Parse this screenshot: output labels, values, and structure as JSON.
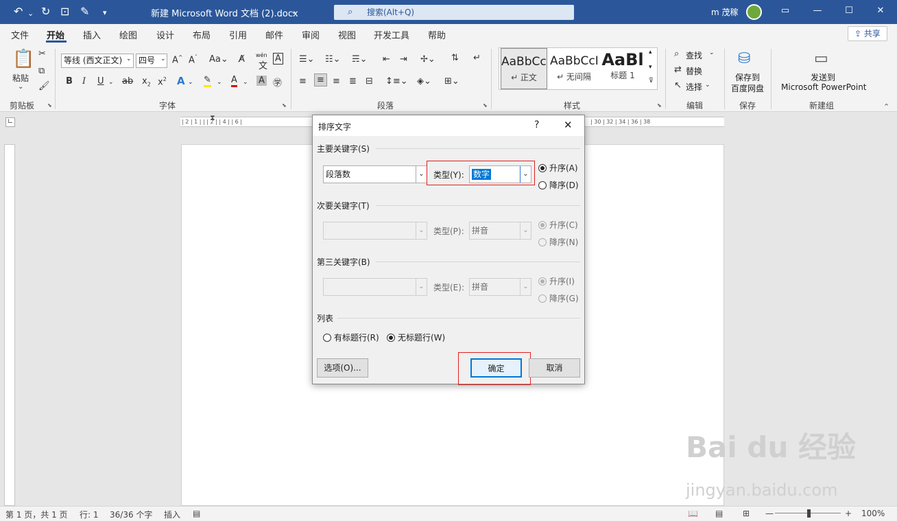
{
  "window": {
    "title": "新建 Microsoft Word 文档 (2).docx",
    "search_placeholder": "搜索(Alt+Q)",
    "user": "m 茂稼",
    "share_label": "共享"
  },
  "tabs": [
    "文件",
    "开始",
    "插入",
    "绘图",
    "设计",
    "布局",
    "引用",
    "邮件",
    "审阅",
    "视图",
    "开发工具",
    "帮助"
  ],
  "ribbon": {
    "clipboard": {
      "paste_label": "粘贴",
      "group_label": "剪贴板"
    },
    "font": {
      "font_name": "等线 (西文正文)",
      "font_size": "四号",
      "group_label": "字体",
      "wen_label": "wén"
    },
    "paragraph": {
      "group_label": "段落"
    },
    "styles": {
      "group_label": "样式",
      "items": [
        {
          "sample": "AaBbCcI",
          "name": "↵ 正文"
        },
        {
          "sample": "AaBbCcI",
          "name": "↵ 无间隔"
        },
        {
          "sample": "AaBl",
          "name": "标题 1"
        }
      ]
    },
    "editing": {
      "find": "查找",
      "replace": "替换",
      "select": "选择",
      "group_label": "编辑"
    },
    "save": {
      "label_1": "保存到",
      "label_2": "百度网盘",
      "group_label": "保存"
    },
    "newgroup": {
      "label_1": "发送到",
      "label_2": "Microsoft PowerPoint",
      "group_label": "新建组"
    }
  },
  "ruler": {
    "left_marks": "| 2 | 1 | | | 2 | | 4 | | 6 |",
    "right_marks": "| 30 | 32 | 34 | 36 | 38"
  },
  "dialog": {
    "title": "排序文字",
    "help": "?",
    "primary": {
      "section": "主要关键字(S)",
      "field": "段落数",
      "type_label": "类型(Y):",
      "type_value": "数字",
      "asc": "升序(A)",
      "desc": "降序(D)"
    },
    "secondary": {
      "section": "次要关键字(T)",
      "field": "",
      "type_label": "类型(P):",
      "type_value": "拼音",
      "asc": "升序(C)",
      "desc": "降序(N)"
    },
    "tertiary": {
      "section": "第三关键字(B)",
      "field": "",
      "type_label": "类型(E):",
      "type_value": "拼音",
      "asc": "升序(I)",
      "desc": "降序(G)"
    },
    "list": {
      "section": "列表",
      "with_header": "有标题行(R)",
      "no_header": "无标题行(W)"
    },
    "options_button": "选项(O)...",
    "ok_button": "确定",
    "cancel_button": "取消"
  },
  "status": {
    "page": "第 1 页，共 1 页",
    "line": "行: 1",
    "words": "36/36 个字",
    "mode": "插入",
    "zoom": "100%"
  },
  "watermark": {
    "brand": "Bai du 经验",
    "url": "jingyan.baidu.com"
  }
}
